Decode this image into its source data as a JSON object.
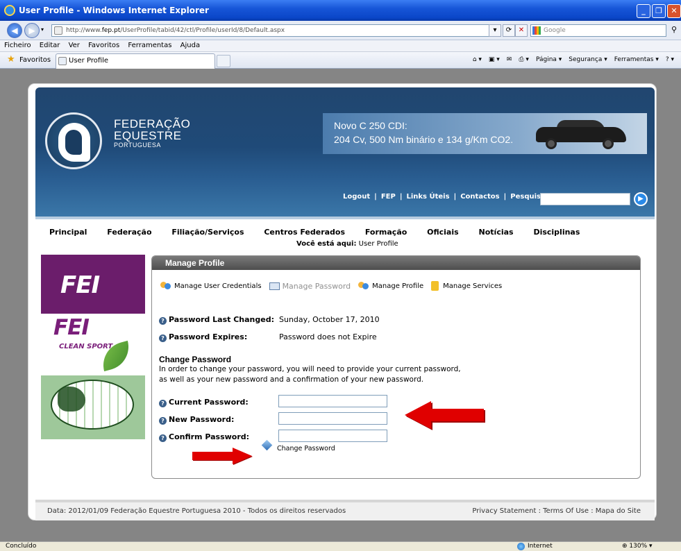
{
  "window": {
    "title": "User Profile - Windows Internet Explorer",
    "url_prefix": "http://www.",
    "url_domain": "fep.pt",
    "url_rest": "/UserProfile/tabid/42/ctl/Profile/userId/8/Default.aspx",
    "search_placeholder": "Google"
  },
  "menu": [
    "Ficheiro",
    "Editar",
    "Ver",
    "Favoritos",
    "Ferramentas",
    "Ajuda"
  ],
  "favorites": {
    "label": "Favoritos",
    "tab_title": "User Profile",
    "commands": [
      "Página ▾",
      "Segurança ▾",
      "Ferramentas ▾"
    ]
  },
  "site": {
    "brand_line1": "FEDERAÇÃO",
    "brand_line2": "EQUESTRE",
    "brand_line3": "PORTUGUESA",
    "ad_line1": "Novo C 250 CDI:",
    "ad_line2": "204 Cv, 500 Nm binário e 134 g/Km CO2.",
    "top_links": [
      "Logout",
      "FEP",
      "Links Úteis",
      "Contactos"
    ],
    "search_label": "Pesquisar:",
    "nav": [
      "Principal",
      "Federação",
      "Filiação/Serviços",
      "Centros Federados",
      "Formação",
      "Oficiais",
      "Notícias",
      "Disciplinas"
    ],
    "breadcrumb_label": "Você está aqui:",
    "breadcrumb_value": "User Profile"
  },
  "sidebar": {
    "fei_text": "FEI",
    "fei_clean_text": "FEI",
    "clean_sport": "CLEAN SPORT"
  },
  "module": {
    "title": "Manage Profile",
    "tabs": [
      "Manage User Credentials",
      "Manage Password",
      "Manage Profile",
      "Manage Services"
    ],
    "password_last_changed_label": "Password Last Changed:",
    "password_last_changed_value": "Sunday, October 17, 2010",
    "password_expires_label": "Password Expires:",
    "password_expires_value": "Password does not Expire",
    "change_title": "Change Password",
    "change_desc_1": "In order to change your password, you will need to provide your current password,",
    "change_desc_2": "as well as your new password and a confirmation of your new password.",
    "current_label": "Current Password:",
    "new_label": "New Password:",
    "confirm_label": "Confirm Password:",
    "change_button": "Change Password"
  },
  "footer": {
    "left": "Data:  2012/01/09   Federação Equestre Portuguesa 2010 - Todos os direitos reservados",
    "right": "Privacy Statement : Terms Of Use : Mapa do Site"
  },
  "status": {
    "left": "Concluído",
    "zone": "Internet",
    "zoom": "130%"
  },
  "colors": {
    "header_blue": "#1f4a78",
    "fei_purple": "#6b1d6b",
    "arrow_red": "#e00000"
  }
}
